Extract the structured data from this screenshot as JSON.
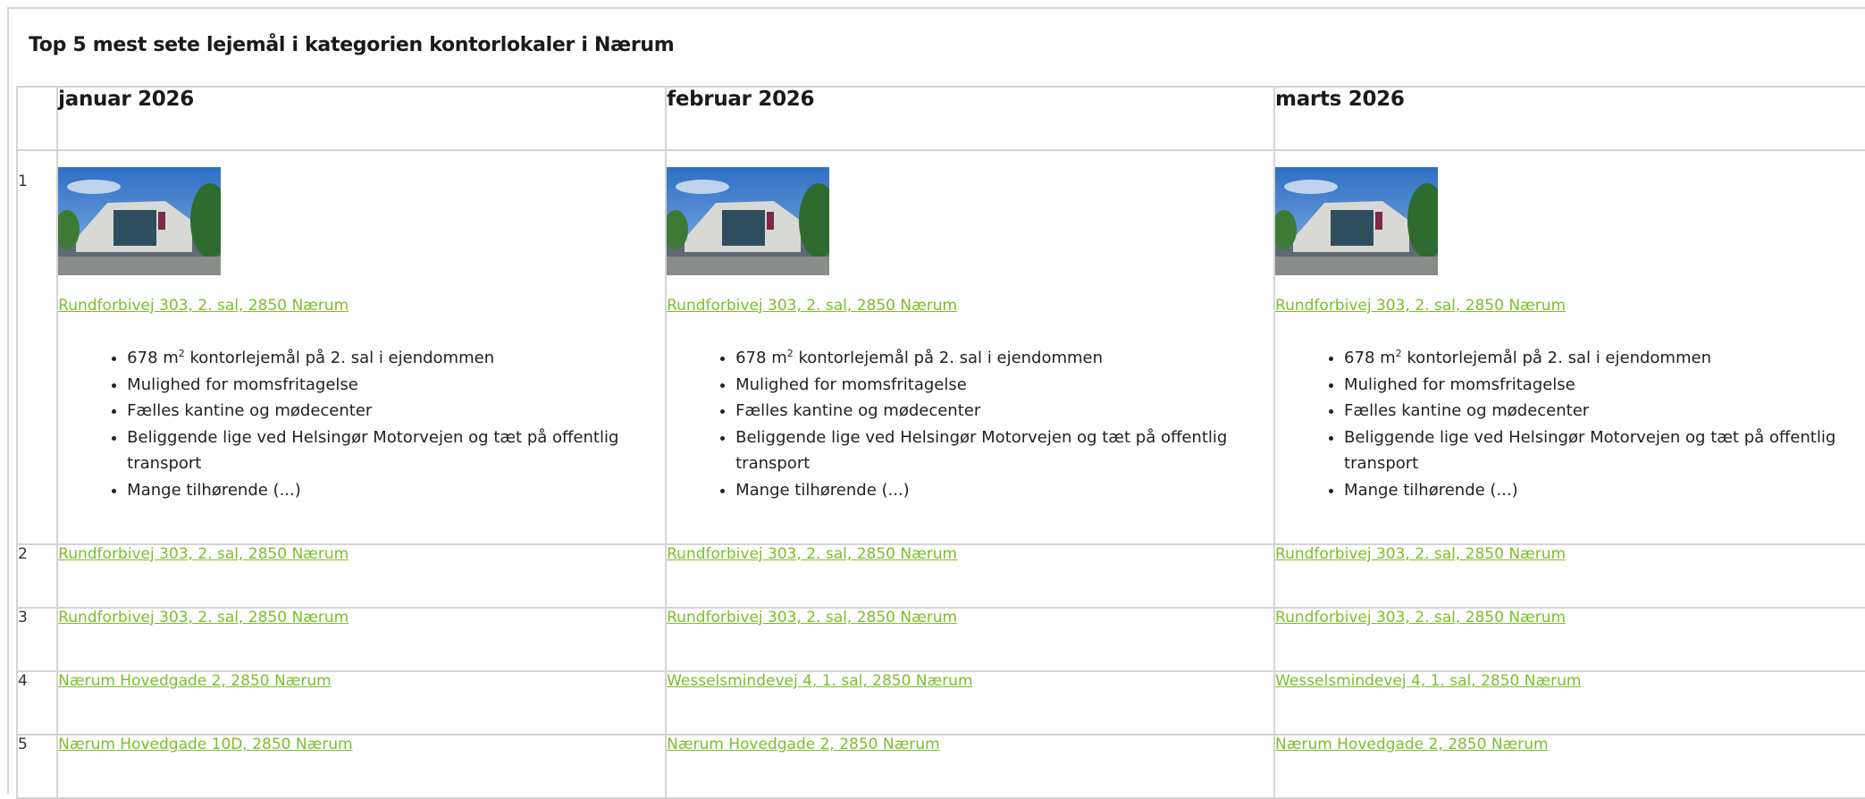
{
  "title": "Top 5 mest sete lejemål i kategorien kontorlokaler i Nærum",
  "months": [
    "januar 2026",
    "februar 2026",
    "marts 2026"
  ],
  "colors": {
    "link": "#7bbf2a",
    "border": "#d4d4d4",
    "text": "#222222"
  },
  "rank1": {
    "rank": "1",
    "link": "Rundforbivej 303, 2. sal, 2850 Nærum",
    "bullet1_pre": "678 m",
    "bullet1_sup": "2",
    "bullet1_post": " kontorlejemål på 2. sal i ejendommen",
    "bullets": [
      "Mulighed for momsfritagelse",
      "Fælles kantine og mødecenter",
      "Beliggende lige ved Helsingør Motorvejen og tæt på offentlig transport",
      "Mange tilhørende (...)"
    ],
    "image": "office-building-photo"
  },
  "rows": [
    {
      "rank": "2",
      "cells": [
        "Rundforbivej 303, 2. sal, 2850 Nærum",
        "Rundforbivej 303, 2. sal, 2850 Nærum",
        "Rundforbivej 303, 2. sal, 2850 Nærum"
      ]
    },
    {
      "rank": "3",
      "cells": [
        "Rundforbivej 303, 2. sal, 2850 Nærum",
        "Rundforbivej 303, 2. sal, 2850 Nærum",
        "Rundforbivej 303, 2. sal, 2850 Nærum"
      ]
    },
    {
      "rank": "4",
      "cells": [
        "Nærum Hovedgade 2, 2850 Nærum",
        "Wesselsmindevej 4, 1. sal, 2850 Nærum",
        "Wesselsmindevej 4, 1. sal, 2850 Nærum"
      ]
    },
    {
      "rank": "5",
      "cells": [
        "Nærum Hovedgade 10D, 2850 Nærum",
        "Nærum Hovedgade 2, 2850 Nærum",
        "Nærum Hovedgade 2, 2850 Nærum"
      ]
    }
  ]
}
